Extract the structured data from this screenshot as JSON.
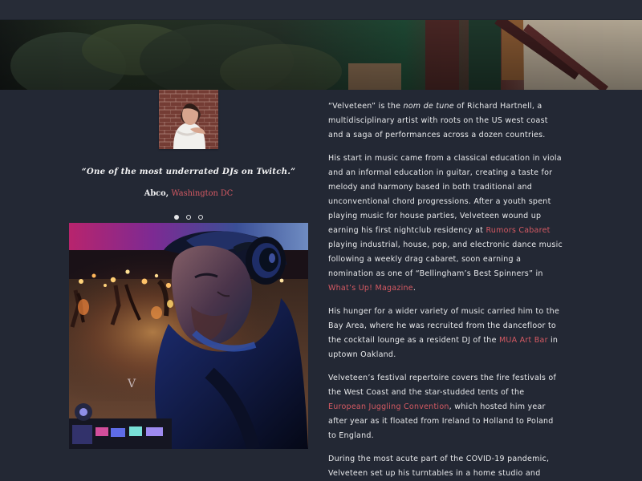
{
  "testimonial": {
    "quote": "“One of the most underrated DJs on Twitch.”",
    "name": "Abco",
    "separator": ", ",
    "location": "Washington DC",
    "pagination": {
      "current": 1,
      "total": 3
    }
  },
  "photo": {
    "signature": "V"
  },
  "bio": {
    "p1": {
      "a": "“Velveteen” is the ",
      "em": "nom de tune",
      "b": " of Richard Hartnell, a multidisciplinary artist with roots on the US west coast and a saga of performances across a dozen countries."
    },
    "p2": {
      "a": "His start in music came from a classical education in viola and an informal education in guitar, creating a taste for melody and harmony based in both traditional and unconventional chord progressions. After a youth spent playing music for house parties, Velveteen wound up earning his first nightclub residency at ",
      "link1": "Rumors Cabaret",
      "b": " playing industrial, house, pop, and electronic dance music following a weekly drag cabaret, soon earning a nomination as one of “Bellingham’s Best Spinners” in ",
      "link2": "What’s Up! Magazine",
      "c": "."
    },
    "p3": {
      "a": "His hunger for a wider variety of music carried him to the Bay Area, where he was recruited from the dancefloor to the cocktail lounge as a resident DJ of the ",
      "link": "MUA Art Bar",
      "b": " in uptown Oakland."
    },
    "p4": {
      "a": "Velveteen’s festival repertoire covers the fire festivals of the West Coast and the star-studded tents of the ",
      "link": "European Juggling Convention",
      "b": ", which hosted him year after year as it floated from Ireland to Holland to Poland to England."
    },
    "p5": {
      "a": "During the most acute part of the COVID-19 pandemic, Velveteen set up his turntables in a home studio and"
    }
  },
  "colors": {
    "background": "#232834",
    "link": "#d65a63",
    "text": "#e9eaec"
  },
  "icons": {
    "pagination": "dot-indicator-icon"
  }
}
